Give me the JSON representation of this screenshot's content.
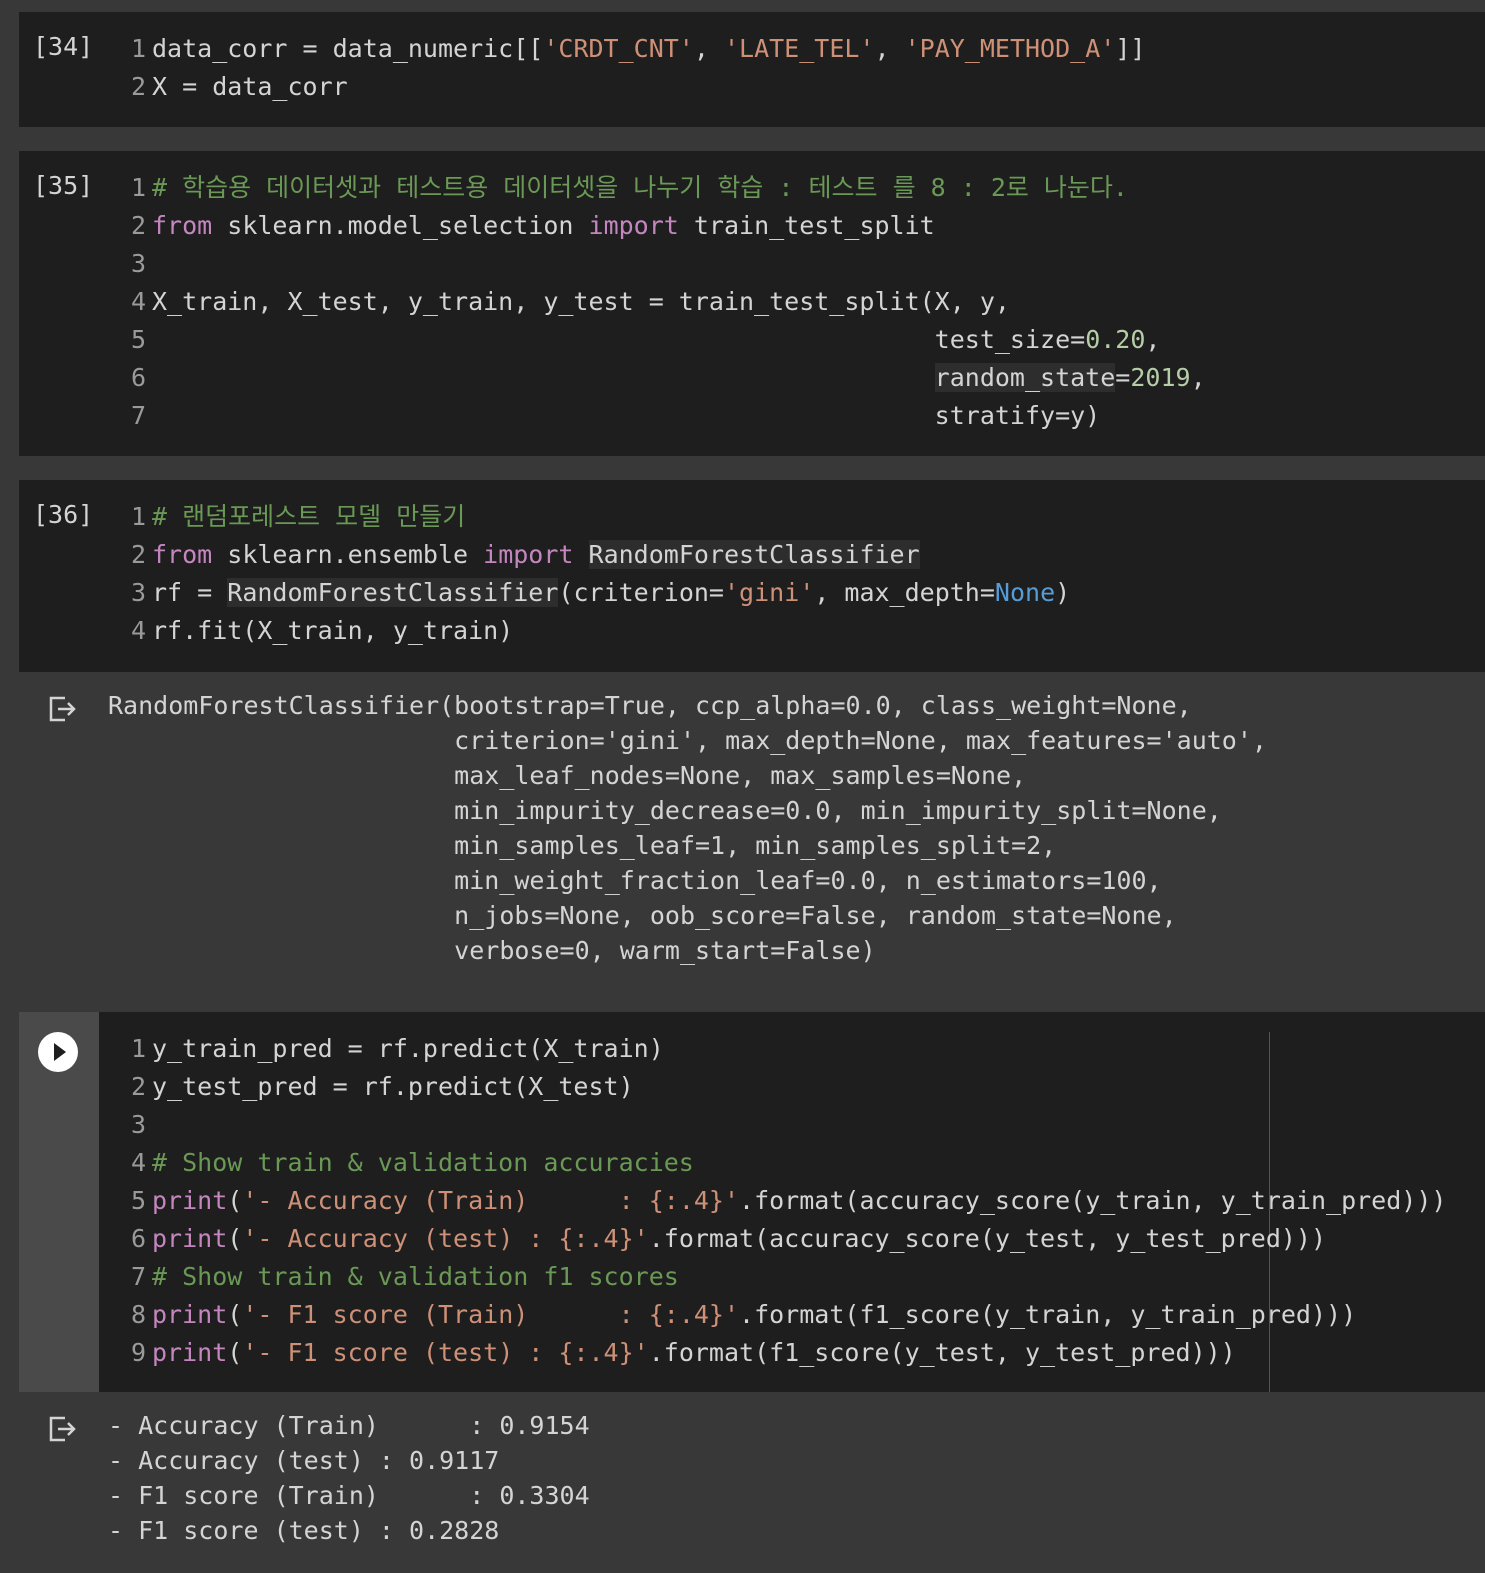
{
  "cells": [
    {
      "count": "[34]",
      "lines": [
        {
          "n": "1",
          "segs": [
            [
              "",
              "data_corr = data_numeric[["
            ],
            [
              "str",
              "'CRDT_CNT'"
            ],
            [
              "",
              ", "
            ],
            [
              "str",
              "'LATE_TEL'"
            ],
            [
              "",
              ", "
            ],
            [
              "str",
              "'PAY_METHOD_A'"
            ],
            [
              "",
              "]]"
            ]
          ]
        },
        {
          "n": "2",
          "segs": [
            [
              "",
              "X = data_corr"
            ]
          ]
        }
      ]
    },
    {
      "count": "[35]",
      "lines": [
        {
          "n": "1",
          "segs": [
            [
              "cm",
              "# 학습용 데이터셋과 테스트용 데이터셋을 나누기 학습 : 테스트 를 8 : 2로 나눈다."
            ]
          ]
        },
        {
          "n": "2",
          "segs": [
            [
              "kw",
              "from"
            ],
            [
              "",
              " sklearn.model_selection "
            ],
            [
              "kw",
              "import"
            ],
            [
              "",
              " train_test_split"
            ]
          ]
        },
        {
          "n": "3",
          "segs": [
            [
              "",
              ""
            ]
          ]
        },
        {
          "n": "4",
          "segs": [
            [
              "",
              "X_train, X_test, y_train, y_test = train_test_split(X, y,"
            ]
          ]
        },
        {
          "n": "5",
          "segs": [
            [
              "",
              "                                                    test_size="
            ],
            [
              "num",
              "0.20"
            ],
            [
              "",
              ","
            ]
          ]
        },
        {
          "n": "6",
          "segs": [
            [
              "",
              "                                                    "
            ],
            [
              "hl",
              "random_state"
            ],
            [
              "",
              "="
            ],
            [
              "num",
              "2019"
            ],
            [
              "",
              ","
            ]
          ]
        },
        {
          "n": "7",
          "segs": [
            [
              "",
              "                                                    stratify=y)"
            ]
          ]
        }
      ]
    },
    {
      "count": "[36]",
      "lines": [
        {
          "n": "1",
          "segs": [
            [
              "cm",
              "# 랜덤포레스트 모델 만들기"
            ]
          ]
        },
        {
          "n": "2",
          "segs": [
            [
              "kw",
              "from"
            ],
            [
              "",
              " sklearn.ensemble "
            ],
            [
              "kw",
              "import"
            ],
            [
              "",
              " "
            ],
            [
              "hl",
              "RandomForestClassifier"
            ]
          ]
        },
        {
          "n": "3",
          "segs": [
            [
              "",
              "rf = "
            ],
            [
              "hl",
              "RandomForestClassifier"
            ],
            [
              "",
              "(criterion="
            ],
            [
              "str",
              "'gini'"
            ],
            [
              "",
              ", max_depth="
            ],
            [
              "const",
              "None"
            ],
            [
              "",
              ")"
            ]
          ]
        },
        {
          "n": "4",
          "segs": [
            [
              "",
              "rf.fit(X_train, y_train)"
            ]
          ]
        }
      ],
      "output": "RandomForestClassifier(bootstrap=True, ccp_alpha=0.0, class_weight=None,\n                       criterion='gini', max_depth=None, max_features='auto',\n                       max_leaf_nodes=None, max_samples=None,\n                       min_impurity_decrease=0.0, min_impurity_split=None,\n                       min_samples_leaf=1, min_samples_split=2,\n                       min_weight_fraction_leaf=0.0, n_estimators=100,\n                       n_jobs=None, oob_score=False, random_state=None,\n                       verbose=0, warm_start=False)"
    },
    {
      "count": "",
      "lines": [
        {
          "n": "1",
          "segs": [
            [
              "",
              "y_train_pred = rf.predict(X_train)"
            ]
          ]
        },
        {
          "n": "2",
          "segs": [
            [
              "",
              "y_test_pred = rf.predict(X_test)"
            ]
          ]
        },
        {
          "n": "3",
          "segs": [
            [
              "",
              ""
            ]
          ]
        },
        {
          "n": "4",
          "segs": [
            [
              "cm",
              "# Show train & validation accuracies"
            ]
          ]
        },
        {
          "n": "5",
          "segs": [
            [
              "kw",
              "print"
            ],
            [
              "",
              "("
            ],
            [
              "str",
              "'- Accuracy (Train)      : {:.4}'"
            ],
            [
              "",
              ".format(accuracy_score(y_train, y_train_pred)))"
            ]
          ]
        },
        {
          "n": "6",
          "segs": [
            [
              "kw",
              "print"
            ],
            [
              "",
              "("
            ],
            [
              "str",
              "'- Accuracy (test) : {:.4}'"
            ],
            [
              "",
              ".format(accuracy_score(y_test, y_test_pred)))"
            ]
          ]
        },
        {
          "n": "7",
          "segs": [
            [
              "cm",
              "# Show train & validation f1 scores"
            ]
          ]
        },
        {
          "n": "8",
          "segs": [
            [
              "kw",
              "print"
            ],
            [
              "",
              "("
            ],
            [
              "str",
              "'- F1 score (Train)      : {:.4}'"
            ],
            [
              "",
              ".format(f1_score(y_train, y_train_pred)))"
            ]
          ]
        },
        {
          "n": "9",
          "segs": [
            [
              "kw",
              "print"
            ],
            [
              "",
              "("
            ],
            [
              "str",
              "'- F1 score (test) : {:.4}'"
            ],
            [
              "",
              ".format(f1_score(y_test, y_test_pred)))"
            ]
          ]
        }
      ],
      "output": "- Accuracy (Train)      : 0.9154\n- Accuracy (test) : 0.9117\n- F1 score (Train)      : 0.3304\n- F1 score (test) : 0.2828"
    }
  ]
}
